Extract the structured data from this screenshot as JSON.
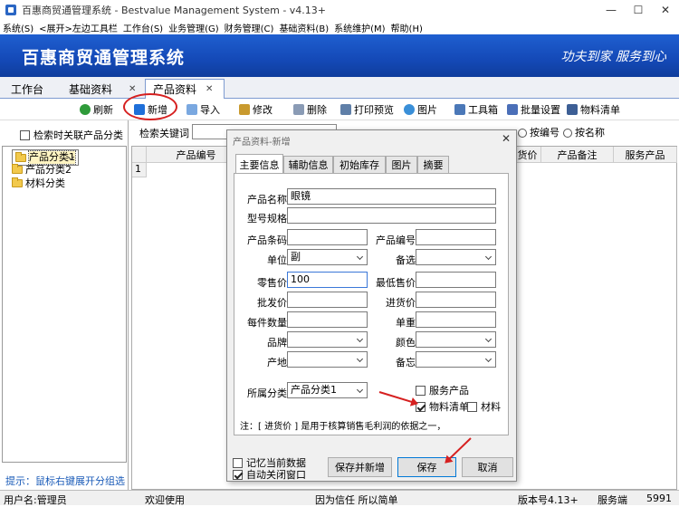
{
  "window": {
    "title": "百惠商贸通管理系统 - Bestvalue Management System - v4.13+"
  },
  "menu": [
    "系统(S)",
    "<展开>左边工具栏",
    "工作台(S)",
    "业务管理(G)",
    "财务管理(C)",
    "基础资料(B)",
    "系统维护(M)",
    "帮助(H)"
  ],
  "banner": {
    "title": "百惠商贸通管理系统",
    "slogan": "功夫到家  服务到心"
  },
  "tabs": [
    {
      "label": "工作台"
    },
    {
      "label": "基础资料"
    },
    {
      "label": "产品资料"
    }
  ],
  "toolbar": {
    "refresh": "刷新",
    "add": "新增",
    "import": "导入",
    "edit": "修改",
    "delete": "删除",
    "print_preview": "打印预览",
    "image": "图片",
    "toolbox": "工具箱",
    "batch_settings": "批量设置",
    "bom": "物料清单"
  },
  "left": {
    "search_related": "检索时关联产品分类",
    "tree": [
      "产品分类1",
      "产品分类2",
      "材料分类"
    ],
    "hint": "提示：鼠标右键展开分组选项"
  },
  "search": {
    "label": "检索关键词",
    "radio_code": "按编号",
    "radio_name": "按名称"
  },
  "grid": {
    "headers": [
      "产品编号",
      "货价",
      "产品备注",
      "服务产品"
    ],
    "row_num": "1"
  },
  "dialog": {
    "title": "产品资料-新增",
    "tabs": [
      "主要信息",
      "辅助信息",
      "初始库存",
      "图片",
      "摘要"
    ],
    "labels": {
      "name": "产品名称",
      "spec": "型号规格",
      "barcode": "产品条码",
      "code": "产品编号",
      "unit": "单位",
      "option": "备选",
      "retail": "零售价",
      "min_price": "最低售价",
      "wholesale": "批发价",
      "purchase": "进货价",
      "per_qty": "每件数量",
      "weight": "单重",
      "brand": "品牌",
      "color": "颜色",
      "origin": "产地",
      "memo": "备忘",
      "category": "所属分类"
    },
    "values": {
      "name": "眼镜",
      "spec": "",
      "barcode": "",
      "code": "",
      "unit": "副",
      "option": "",
      "retail": "100",
      "min_price": "",
      "wholesale": "",
      "purchase": "",
      "per_qty": "",
      "weight": "",
      "brand": "",
      "color": "",
      "origin": "",
      "memo": "",
      "category": "产品分类1"
    },
    "checks": {
      "service": "服务产品",
      "bom": "物料清单",
      "material": "材料"
    },
    "note": "注：[ 进货价 ] 是用于核算销售毛利润的依据之一，",
    "remember": "记忆当前数据",
    "auto_close": "自动关闭窗口",
    "buttons": {
      "save_new": "保存并新增",
      "save": "保存",
      "cancel": "取消"
    }
  },
  "status": {
    "user": "用户名:管理员",
    "welcome": "欢迎使用",
    "motto": "因为信任 所以简单",
    "version": "版本号4.13+",
    "server": "服务端",
    "port": "5991"
  },
  "colors": {
    "accent": "#1449b7",
    "annotation": "#d62020"
  }
}
